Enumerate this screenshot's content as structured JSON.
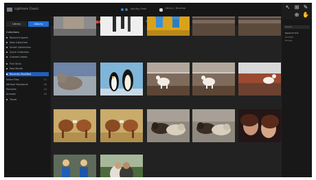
{
  "app": {
    "title": "Lightroom Classic"
  },
  "top_center": {
    "line1": "Identity Plate",
    "line2": "Library | Develop"
  },
  "sidebar": {
    "tabs": [
      {
        "label": "Library"
      },
      {
        "label": "Albums"
      }
    ],
    "items": [
      {
        "label": "Collections"
      },
      {
        "label": "Recent Imports",
        "count": ""
      },
      {
        "label": "New Collection",
        "count": ""
      },
      {
        "label": "Smart Collections",
        "count": ""
      },
      {
        "label": "Quick Collection",
        "count": ""
      },
      {
        "label": "Colored Labels",
        "count": ""
      },
      {
        "label": "Five Stars",
        "count": ""
      },
      {
        "label": "Past Month",
        "count": ""
      },
      {
        "label": "Recently Modified",
        "count": ""
      },
      {
        "label": "Video Files",
        "count": "12"
      },
      {
        "label": "Without Keywords",
        "count": "18"
      },
      {
        "label": "Portraits",
        "count": "24"
      },
      {
        "label": "Animals",
        "count": "16"
      },
      {
        "label": "Travel",
        "count": ""
      }
    ]
  },
  "filter_bar": {
    "label": "Filter",
    "sort_label": "Sort",
    "right_label": "Thumbnails"
  },
  "chip_colors": [
    "#d9413b",
    "#e4a23a",
    "#d7cf48",
    "#4aa84e",
    "#3a7fd2",
    "#8b58c4"
  ],
  "right_panel": {
    "search_placeholder": "Search",
    "header": "Keyword List",
    "lines": [
      "Animals",
      "Horses",
      "Penguins",
      "People"
    ]
  },
  "photos": [
    {
      "subject": "partial-gray"
    },
    {
      "subject": "partial-legs"
    },
    {
      "subject": "partial-yellow-figures"
    },
    {
      "subject": "partial-fence"
    },
    {
      "subject": "partial-fence"
    },
    {
      "subject": "seal"
    },
    {
      "subject": "penguins"
    },
    {
      "subject": "goats"
    },
    {
      "subject": "goats"
    },
    {
      "subject": "goat-fence"
    },
    {
      "subject": "horses"
    },
    {
      "subject": "horses"
    },
    {
      "subject": "cats"
    },
    {
      "subject": "cats"
    },
    {
      "subject": "women-portrait"
    },
    {
      "subject": "women-blue"
    },
    {
      "subject": "couple"
    }
  ]
}
